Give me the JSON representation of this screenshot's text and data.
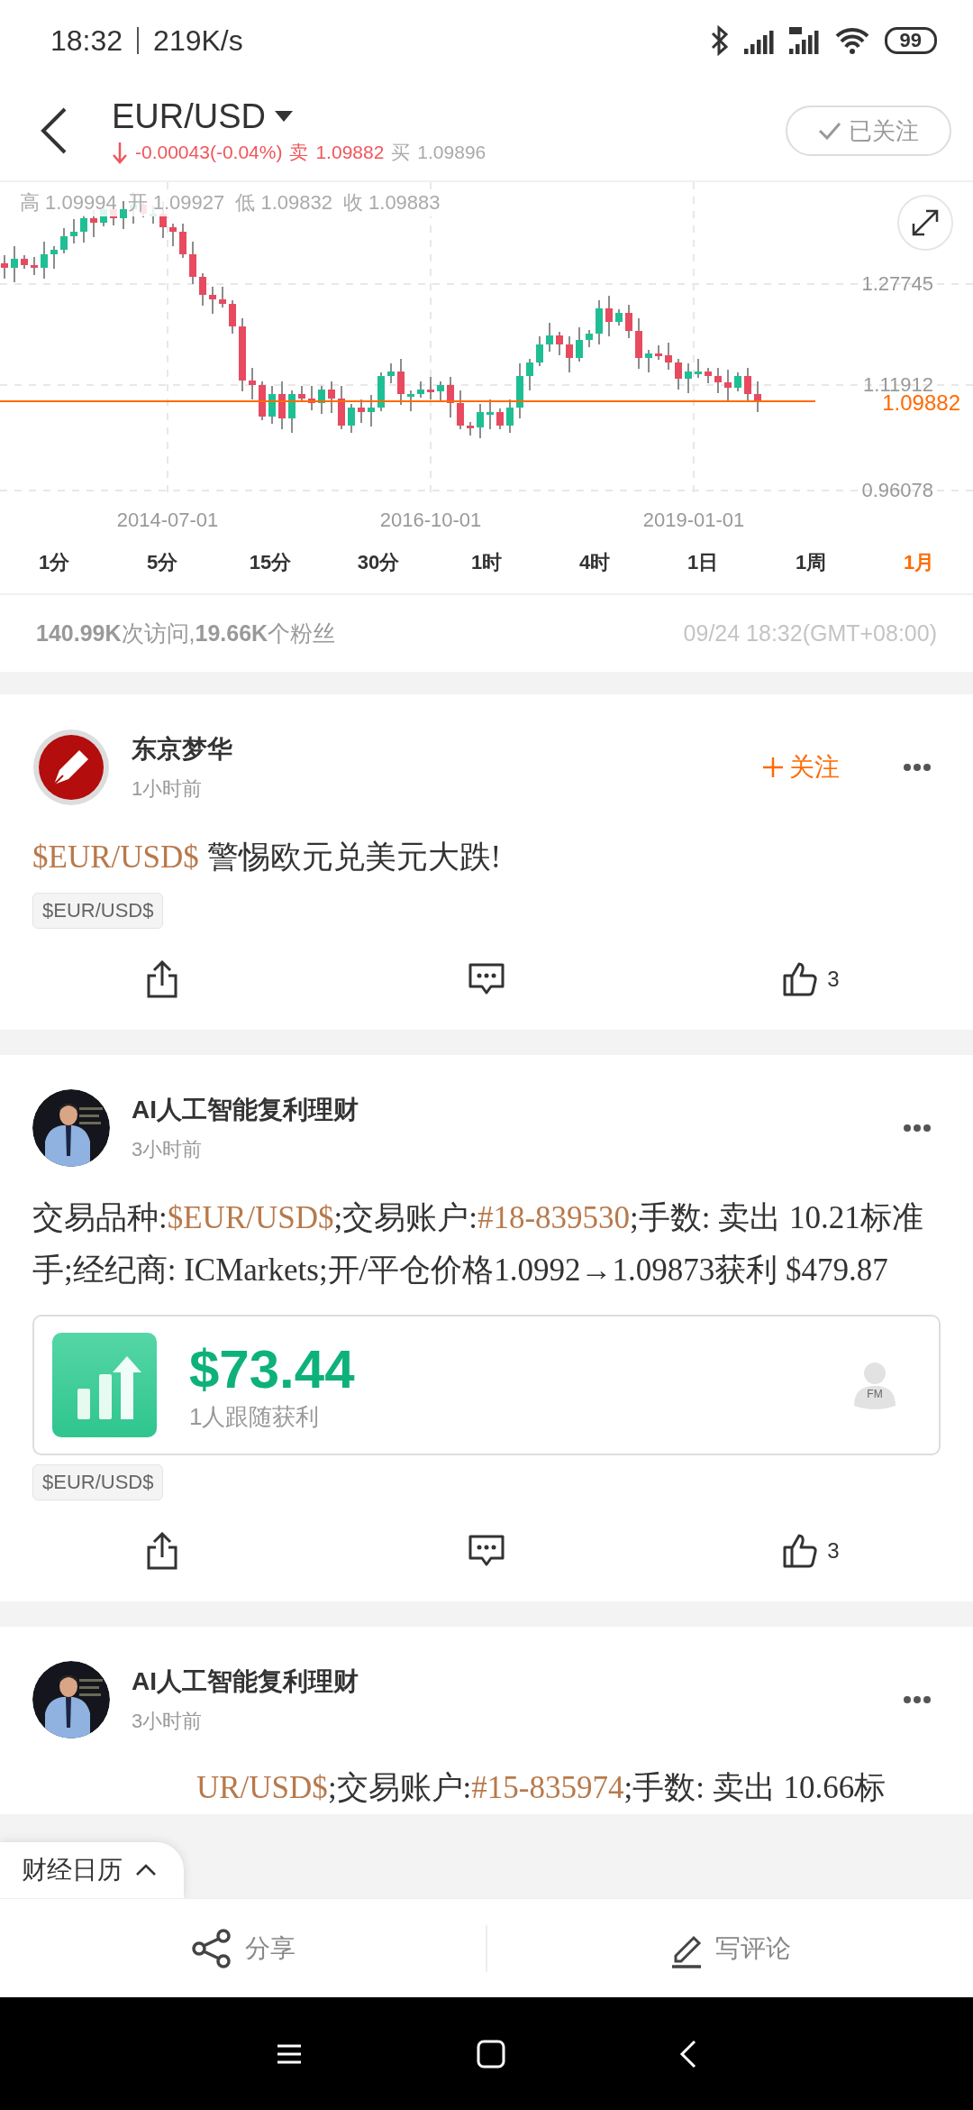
{
  "status_bar": {
    "time": "18:32",
    "speed": "219K/s",
    "battery": "99"
  },
  "header": {
    "title": "EUR/USD",
    "change": "-0.00043(-0.04%)",
    "sell_label": "卖",
    "sell_price": "1.09882",
    "buy_label": "买",
    "buy_price": "1.09896",
    "follow_button": {
      "label": "已关注",
      "followed": true
    }
  },
  "chart": {
    "ohlc": [
      {
        "label": "高",
        "value": "1.09994"
      },
      {
        "label": "开",
        "value": "1.09927"
      },
      {
        "label": "低",
        "value": "1.09832"
      },
      {
        "label": "收",
        "value": "1.09883"
      }
    ],
    "y_labels": [
      "1.27745",
      "1.11912",
      "0.96078"
    ],
    "x_labels": [
      "2014-07-01",
      "2016-10-01",
      "2019-01-01"
    ],
    "current_price": "1.09882"
  },
  "periods": [
    {
      "label": "1分",
      "selected": false
    },
    {
      "label": "5分",
      "selected": false
    },
    {
      "label": "15分",
      "selected": false
    },
    {
      "label": "30分",
      "selected": false
    },
    {
      "label": "1时",
      "selected": false
    },
    {
      "label": "4时",
      "selected": false
    },
    {
      "label": "1日",
      "selected": false
    },
    {
      "label": "1周",
      "selected": false
    },
    {
      "label": "1月",
      "selected": true
    }
  ],
  "stats": {
    "summary": "**140.99K**次访问,**19.66K**个粉丝",
    "time": "09/24 18:32(GMT+08:00)"
  },
  "posts": [
    {
      "author": "东京梦华",
      "avatar": {
        "kind": "logo"
      },
      "time": "1小时前",
      "follow": {
        "label": "关注",
        "followed": false
      },
      "body": [
        {
          "kind": "link",
          "text": "$EUR/USD$"
        },
        {
          "kind": "plain",
          "text": " 警惕欧元兑美元大跌!"
        }
      ],
      "tags": [
        "$EUR/USD$"
      ],
      "likes": "3"
    },
    {
      "author": "AI人工智能复利理财",
      "avatar": {
        "kind": "picture"
      },
      "time": "3小时前",
      "body": [
        {
          "kind": "plain",
          "text": "交易品种:"
        },
        {
          "kind": "link",
          "text": "$EUR/USD$"
        },
        {
          "kind": "plain",
          "text": ";交易账户:"
        },
        {
          "kind": "link",
          "text": "#18-839530"
        },
        {
          "kind": "plain",
          "text": ";手数: 卖出 10.21标准手;经纪商: ICMarkets;开/平仓价格1.0992→1.09873获利 $479.87"
        }
      ],
      "profit": {
        "amount": "$73.44",
        "caption": "1人跟随获利",
        "badge": "FM"
      },
      "tags": [
        "$EUR/USD$"
      ],
      "likes": "3"
    },
    {
      "author": "AI人工智能复利理财",
      "avatar": {
        "kind": "picture"
      },
      "time": "3小时前",
      "partial": true,
      "body": [
        {
          "kind": "link",
          "text": "UR/USD$"
        },
        {
          "kind": "plain",
          "text": ";交易账户:"
        },
        {
          "kind": "link",
          "text": "#15-835974"
        },
        {
          "kind": "plain",
          "text": ";手数: 卖出 10.66标"
        }
      ]
    }
  ],
  "calendar_button": {
    "label": "财经日历"
  },
  "bottom_bar": [
    {
      "kind": "share",
      "label": "分享"
    },
    {
      "kind": "comment",
      "label": "写评论"
    }
  ]
}
